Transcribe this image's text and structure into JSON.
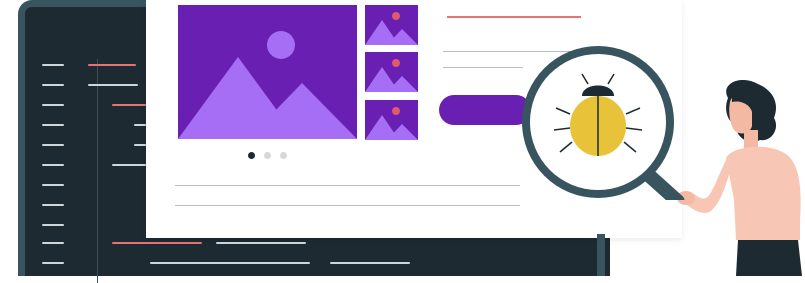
{
  "illustration": {
    "subject": "bug-search-magnifier",
    "colors": {
      "code_bg": "#1e2a31",
      "code_frame": "#38545f",
      "accent_purple": "#6a1fb3",
      "light_purple": "#a66ef5",
      "bug_yellow": "#e8c33a",
      "bug_dark": "#1e2a31",
      "skin": "#f4b9a3",
      "shirt": "#f7c6b5",
      "hair": "#1e2a31",
      "highlight_red": "#e57373"
    },
    "icons": [
      "image-placeholder-icon",
      "bug-icon",
      "magnifying-glass-icon"
    ],
    "gallery": {
      "slides": 3,
      "active_slide": 1,
      "thumbnails": 3
    }
  }
}
